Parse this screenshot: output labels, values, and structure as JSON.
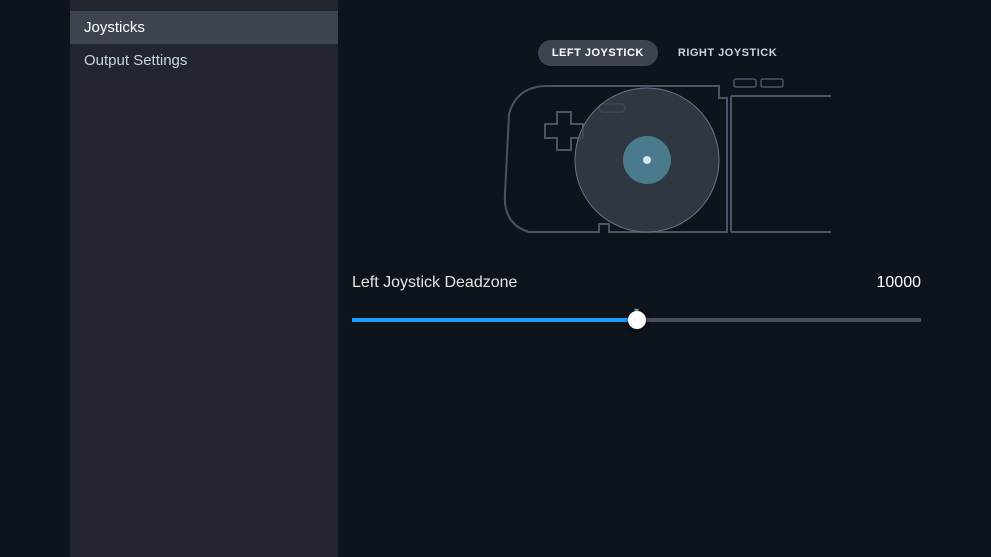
{
  "sidebar": {
    "items": [
      {
        "label": "Joysticks",
        "active": true
      },
      {
        "label": "Output Settings",
        "active": false
      }
    ]
  },
  "tabs": {
    "items": [
      {
        "label": "LEFT JOYSTICK",
        "active": true
      },
      {
        "label": "RIGHT JOYSTICK",
        "active": false
      }
    ]
  },
  "slider": {
    "label": "Left Joystick Deadzone",
    "value_text": "10000",
    "value": 10000,
    "min": 0,
    "max": 20000,
    "percent": 50
  },
  "diagram": {
    "focus": "left-joystick"
  }
}
